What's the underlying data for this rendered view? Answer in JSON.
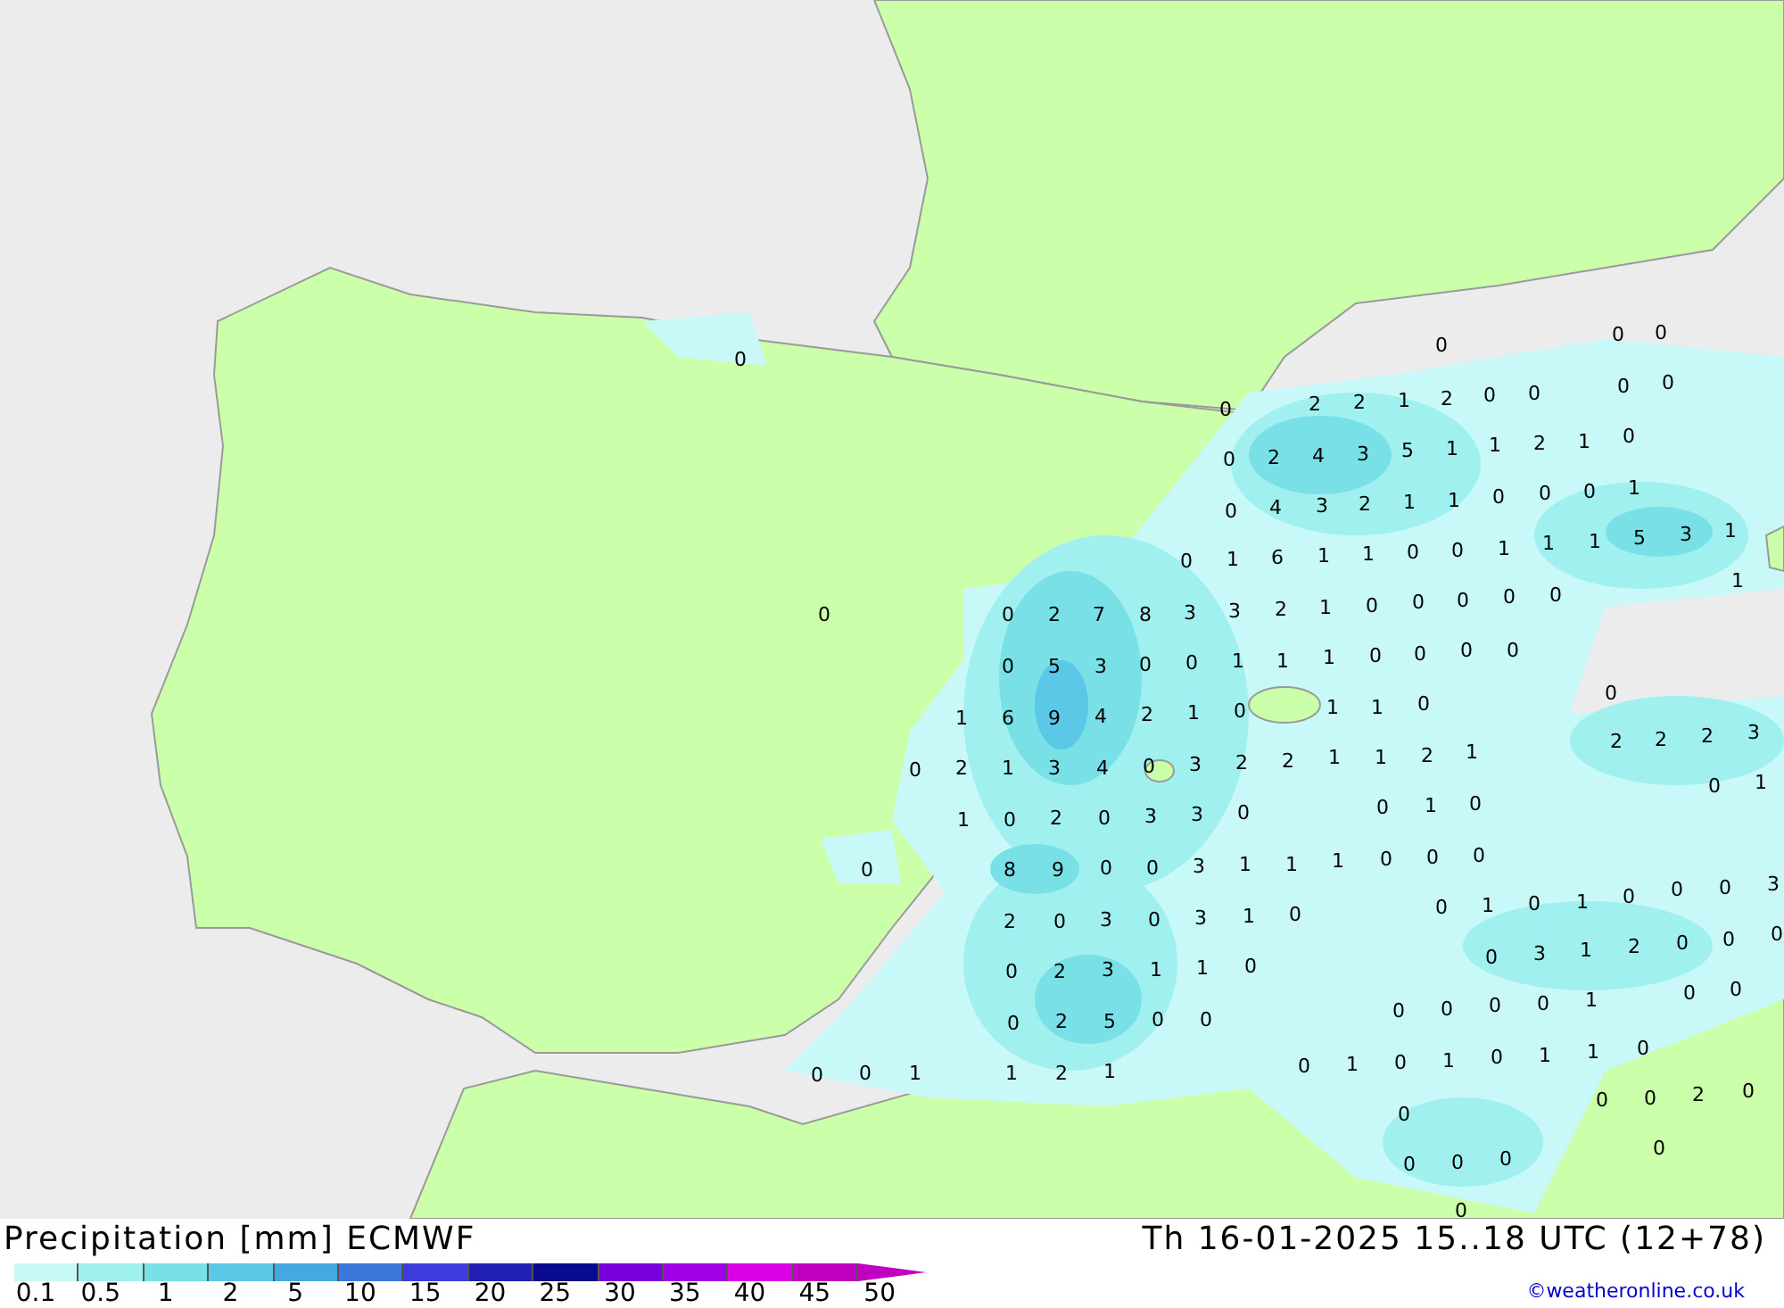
{
  "map": {
    "labels": [
      "0",
      "0",
      "0",
      "0",
      "0",
      "2",
      "2",
      "1",
      "2",
      "0",
      "0",
      "0",
      "0",
      "0",
      "2",
      "4",
      "3",
      "5",
      "1",
      "1",
      "2",
      "1",
      "0",
      "0",
      "4",
      "3",
      "2",
      "1",
      "1",
      "0",
      "0",
      "0",
      "1",
      "0",
      "1",
      "6",
      "1",
      "1",
      "0",
      "0",
      "1",
      "1",
      "1",
      "5",
      "3",
      "1",
      "1",
      "0",
      "0",
      "2",
      "7",
      "8",
      "3",
      "3",
      "2",
      "1",
      "0",
      "0",
      "0",
      "0",
      "0",
      "0",
      "5",
      "3",
      "0",
      "0",
      "1",
      "1",
      "1",
      "0",
      "0",
      "0",
      "0",
      "0",
      "1",
      "6",
      "9",
      "4",
      "2",
      "1",
      "0",
      "1",
      "1",
      "0",
      "2",
      "2",
      "2",
      "3",
      "0",
      "2",
      "1",
      "3",
      "4",
      "0",
      "3",
      "2",
      "2",
      "1",
      "1",
      "2",
      "1",
      "0",
      "1",
      "1",
      "0",
      "2",
      "0",
      "3",
      "3",
      "0",
      "0",
      "1",
      "0",
      "0",
      "8",
      "9",
      "0",
      "0",
      "3",
      "1",
      "1",
      "1",
      "0",
      "0",
      "0",
      "3",
      "2",
      "0",
      "3",
      "0",
      "3",
      "1",
      "0",
      "0",
      "1",
      "0",
      "1",
      "0",
      "0",
      "0",
      "0",
      "2",
      "3",
      "1",
      "1",
      "0",
      "0",
      "3",
      "1",
      "2",
      "0",
      "0",
      "0",
      "0",
      "0",
      "0",
      "2",
      "5",
      "0",
      "0",
      "0",
      "0",
      "0",
      "0",
      "1",
      "0",
      "0",
      "1",
      "1",
      "2",
      "1",
      "0",
      "1",
      "0",
      "1",
      "0",
      "1",
      "1",
      "0",
      "0",
      "0",
      "2",
      "0",
      "0",
      "0",
      "0",
      "0",
      "0",
      "0"
    ]
  },
  "footer": {
    "title": "Precipitation [mm] ECMWF",
    "valid_time": "Th 16-01-2025 15..18 UTC (12+78)",
    "legend": {
      "bins": [
        {
          "color": "#c8f8f8"
        },
        {
          "color": "#a0f0f0"
        },
        {
          "color": "#78e0e6"
        },
        {
          "color": "#5ac8e6"
        },
        {
          "color": "#46a8e0"
        },
        {
          "color": "#3c78dc"
        },
        {
          "color": "#3c3cdc"
        },
        {
          "color": "#2020b4"
        },
        {
          "color": "#0a0a8c"
        },
        {
          "color": "#7800dc"
        },
        {
          "color": "#a000e6"
        },
        {
          "color": "#dc00e6"
        },
        {
          "color": "#c000c0"
        }
      ],
      "labels": [
        "0.1",
        "0.5",
        "1",
        "2",
        "5",
        "10",
        "15",
        "20",
        "25",
        "30",
        "35",
        "40",
        "45",
        "50"
      ]
    },
    "credit": "©weatheronline.co.uk"
  }
}
